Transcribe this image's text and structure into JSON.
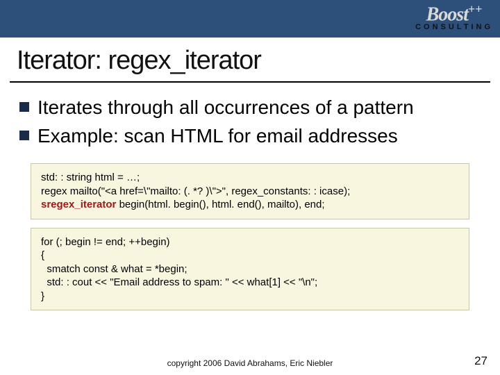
{
  "logo": {
    "main": "Boost",
    "plus": "++",
    "sub": "CONSULTING"
  },
  "title": "Iterator: regex_iterator",
  "bullets": [
    "Iterates through all occurrences of a pattern",
    "Example: scan HTML for email addresses"
  ],
  "code1": {
    "line1": "std: : string html = …;",
    "line2": "regex mailto(\"<a href=\\\"mailto: (. *? )\\\">\", regex_constants: : icase);",
    "hl": "sregex_iterator",
    "line3_rest": " begin(html. begin(), html. end(), mailto), end;"
  },
  "code2": "for (; begin != end; ++begin)\n{\n  smatch const & what = *begin;\n  std: : cout << \"Email address to spam: \" << what[1] << \"\\n\";\n}",
  "copyright": "copyright 2006 David Abrahams, Eric Niebler",
  "page": "27"
}
